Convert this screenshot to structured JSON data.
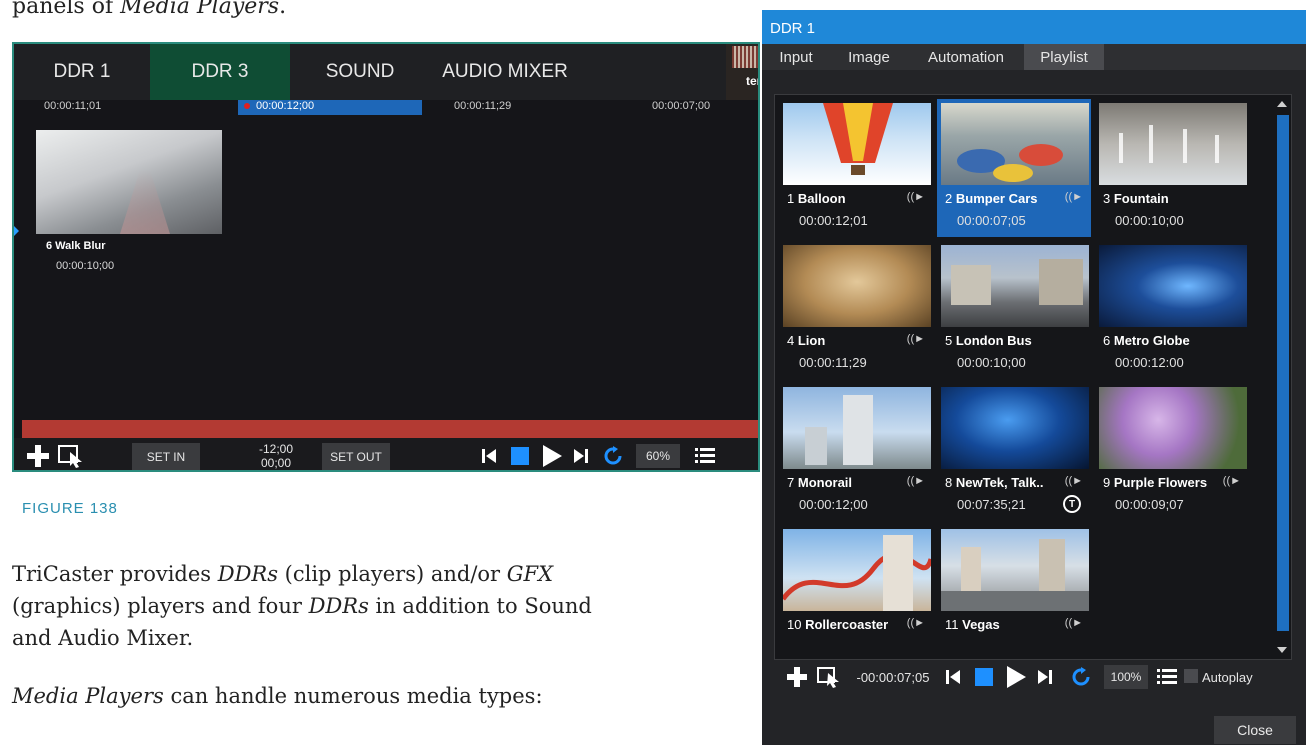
{
  "doc": {
    "intro_prefix": "panels of ",
    "intro_emph": "Media Players",
    "intro_suffix": ".",
    "figure_caption": "FIGURE 138",
    "para1_a": "TriCaster provides ",
    "para1_b": "DDRs",
    "para1_c": " (clip players) and/or ",
    "para1_d": "GFX",
    "para2_a": "(graphics) players and four ",
    "para2_b": "DDRs",
    "para2_c": " in addition to Sound",
    "para3": "and Audio Mixer.",
    "para4_a": "Media Players",
    "para4_b": " can handle numerous media types:"
  },
  "ddr_panel": {
    "tabs": [
      "DDR 1",
      "DDR 3",
      "SOUND",
      "AUDIO MIXER"
    ],
    "active_tab_index": 1,
    "side_text": "ter",
    "top_times": [
      "00:00:11;01",
      "00:00:12;00",
      "00:00:11;29",
      "00:00:07;00"
    ],
    "item_label": "6 Walk Blur",
    "item_time": "00:00:10;00",
    "set_in": "SET IN",
    "tc_top": "-12;00",
    "tc_bottom": "00;00",
    "set_out": "SET OUT",
    "zoom": "60%"
  },
  "dialog": {
    "title": "DDR 1",
    "tabs": [
      "Input",
      "Image",
      "Automation",
      "Playlist"
    ],
    "active_tab": "Playlist",
    "items": [
      {
        "num": "1",
        "name": "Balloon",
        "time": "00:00:12;01"
      },
      {
        "num": "2",
        "name": "Bumper Cars",
        "time": "00:00:07;05"
      },
      {
        "num": "3",
        "name": "Fountain",
        "time": "00:00:10;00"
      },
      {
        "num": "4",
        "name": "Lion",
        "time": "00:00:11;29"
      },
      {
        "num": "5",
        "name": "London Bus",
        "time": "00:00:10;00"
      },
      {
        "num": "6",
        "name": "Metro Globe",
        "time": "00:00:12:00"
      },
      {
        "num": "7",
        "name": "Monorail",
        "time": "00:00:12;00"
      },
      {
        "num": "8",
        "name": "NewTek, Talk..",
        "time": "00:07:35;21"
      },
      {
        "num": "9",
        "name": "Purple Flowers",
        "time": "00:00:09;07"
      },
      {
        "num": "10",
        "name": "Rollercoaster",
        "time": ""
      },
      {
        "num": "11",
        "name": "Vegas",
        "time": ""
      }
    ],
    "selected_item": "2",
    "t_badge": "T",
    "timecode": "-00:00:07;05",
    "zoom": "100%",
    "autoplay_label": "Autoplay",
    "close_label": "Close"
  }
}
